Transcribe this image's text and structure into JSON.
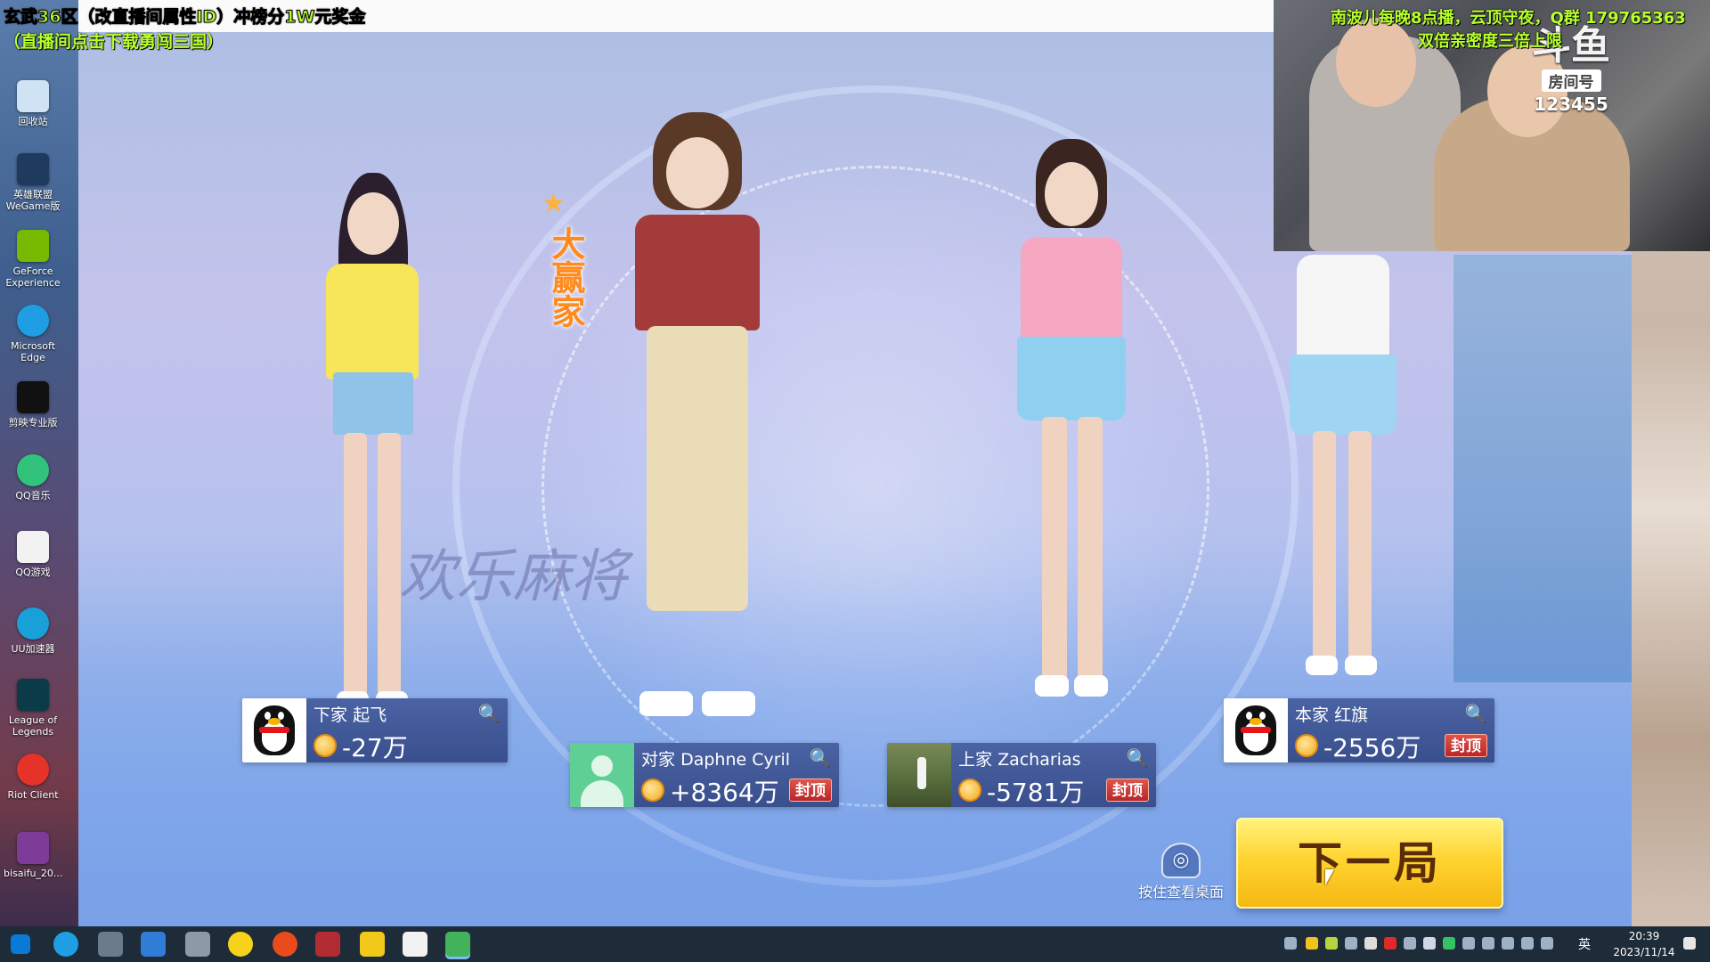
{
  "overlay": {
    "top_left_line1": "玄武36区（改直播间属性ID）冲榜分1W元奖金",
    "top_left_line2": "（直播间点击下载勇闯三国）",
    "top_right_line1": "南波儿每晚8点播，云顶守夜，Q群 179765363",
    "top_right_line2": "双倍亲密度三倍上限"
  },
  "stream": {
    "platform_logo": "斗鱼",
    "room_label": "房间号",
    "room_number": "123455"
  },
  "desktop_icons": [
    {
      "label": "回收站",
      "icon": "recycle-bin-icon",
      "color": "#cfe3f5"
    },
    {
      "label": "英雄联盟\nWeGame版",
      "icon": "league-wegame-icon",
      "color": "#1e3a5f"
    },
    {
      "label": "GeForce\nExperience",
      "icon": "geforce-icon",
      "color": "#76b900"
    },
    {
      "label": "Microsoft\nEdge",
      "icon": "edge-icon",
      "color": "#1f9ee3"
    },
    {
      "label": "剪映专业版",
      "icon": "jianying-icon",
      "color": "#111111"
    },
    {
      "label": "QQ音乐",
      "icon": "qq-music-icon",
      "color": "#31c27c"
    },
    {
      "label": "QQ游戏",
      "icon": "qq-game-icon",
      "color": "#f2f2f2"
    },
    {
      "label": "UU加速器",
      "icon": "uu-accelerator-icon",
      "color": "#1aa0d8"
    },
    {
      "label": "League of\nLegends",
      "icon": "league-icon",
      "color": "#0b3b48"
    },
    {
      "label": "Riot Client",
      "icon": "riot-client-icon",
      "color": "#e6332a"
    },
    {
      "label": "bisaifu_20...",
      "icon": "winrar-icon",
      "color": "#7d3c98"
    }
  ],
  "game": {
    "background_logo": "欢乐麻将",
    "winner_badge": "大赢家",
    "players": [
      {
        "seat": "下家",
        "name": "起飞",
        "score": "-27万",
        "capped": false,
        "avatar": "qq-penguin"
      },
      {
        "seat": "对家",
        "name": "Daphne Cyril",
        "score": "+8364万",
        "capped": true,
        "avatar": "default-silhouette"
      },
      {
        "seat": "上家",
        "name": "Zacharias",
        "score": "-5781万",
        "capped": true,
        "avatar": "photo"
      },
      {
        "seat": "本家",
        "name": "红旗",
        "score": "-2556万",
        "capped": true,
        "avatar": "qq-penguin"
      }
    ],
    "cap_label": "封顶",
    "peek_desktop_label": "按住查看桌面",
    "next_round_label": "下一局"
  },
  "taskbar": {
    "input_language": "英",
    "time": "20:39",
    "date": "2023/11/14"
  },
  "colors": {
    "caption_green": "#b7ff2a",
    "button_gold": "#ffd431",
    "cap_red": "#c8302e",
    "card_blue": "#3f568f"
  }
}
